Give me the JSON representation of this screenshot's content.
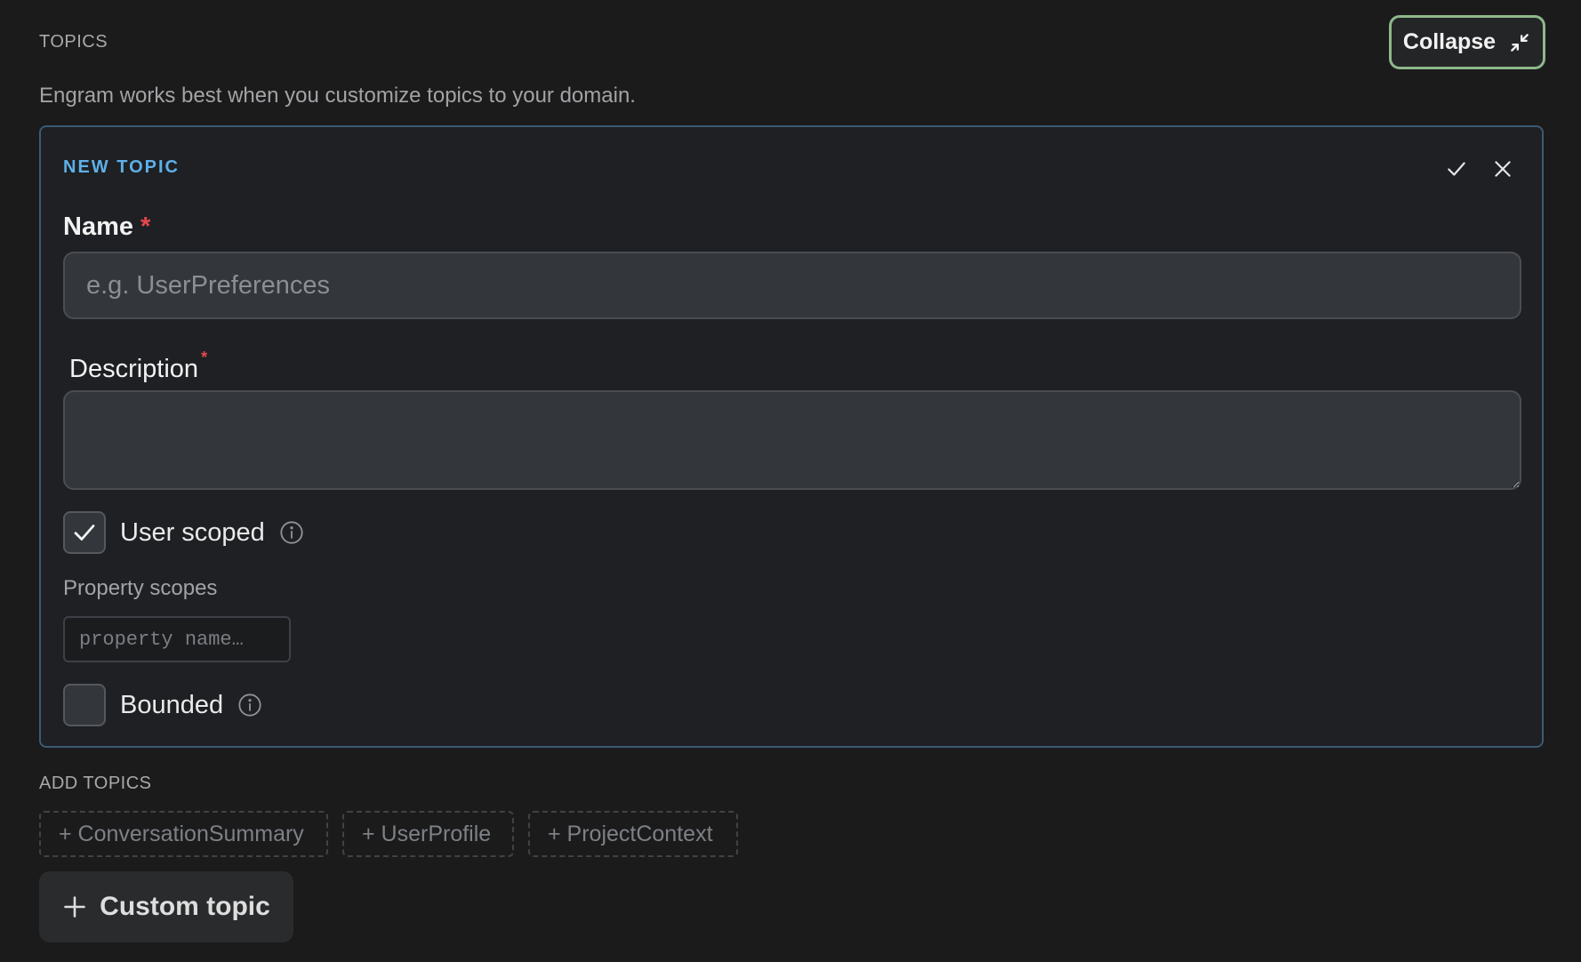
{
  "topics": {
    "section_label": "TOPICS",
    "subtitle": "Engram works best when you customize topics to your domain.",
    "collapse_label": "Collapse"
  },
  "new_topic": {
    "title": "NEW TOPIC",
    "name_label": "Name",
    "name_required": "*",
    "name_placeholder": "e.g. UserPreferences",
    "name_value": "",
    "description_label": "Description",
    "description_required": "*",
    "description_value": "",
    "user_scoped": {
      "label": "User scoped",
      "checked": true
    },
    "property_scopes_label": "Property scopes",
    "property_placeholder": "property name…",
    "bounded": {
      "label": "Bounded",
      "checked": false
    },
    "icons": {
      "confirm": "check-icon",
      "close": "close-icon",
      "info": "info-icon"
    }
  },
  "add_topics": {
    "section_label": "ADD TOPICS",
    "chips": [
      "+ ConversationSummary",
      "+ UserProfile",
      "+ ProjectContext"
    ],
    "custom_label": "Custom topic"
  },
  "colors": {
    "background": "#1b1b1c",
    "accent": "#5fb0e8",
    "collapse_border": "#8eb88a",
    "required": "#e5484d"
  }
}
